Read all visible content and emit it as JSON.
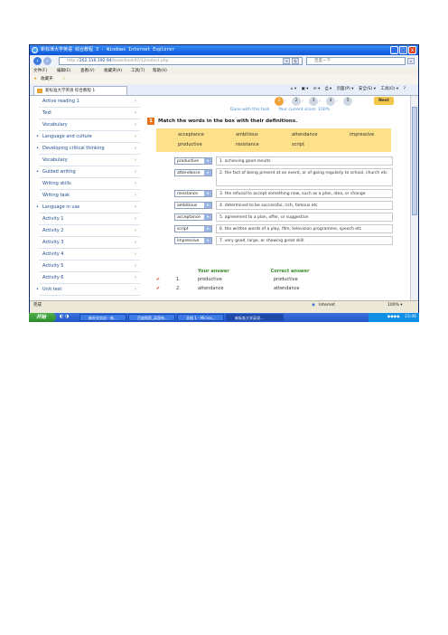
{
  "window": {
    "title": "新标准大学英语 综合教程 3 - Windows Internet Explorer",
    "min": "_",
    "max": "□",
    "close": "x"
  },
  "address": {
    "back_icon": "back-arrow-icon",
    "forward_icon": "forward-arrow-icon",
    "url_prefix": "http://",
    "url_host": "202.116.192.94",
    "url_path": "/book/book97/12/select.php",
    "search_placeholder": "百度一下"
  },
  "menu": [
    "文件(F)",
    "编辑(E)",
    "查看(V)",
    "收藏夹(A)",
    "工具(T)",
    "帮助(H)"
  ],
  "favorites": {
    "label": "收藏夹"
  },
  "tab": {
    "label": "新标准大学英语 综合教程 1"
  },
  "toolbar": {
    "page": "页面(P) ▾",
    "safety": "安全(S) ▾",
    "tools": "工具(O) ▾",
    "help": "?"
  },
  "sidebar": {
    "items": [
      {
        "label": "Active reading 1"
      },
      {
        "label": "Text"
      },
      {
        "label": "Vocabulary"
      },
      {
        "label": "Language and culture"
      },
      {
        "label": "Developing critical thinking"
      },
      {
        "label": "Vocabulary"
      },
      {
        "label": "Guided writing"
      },
      {
        "label": "Writing skills"
      },
      {
        "label": "Writing task"
      },
      {
        "label": "Language in use"
      },
      {
        "label": "Activity 1"
      },
      {
        "label": "Activity 2"
      },
      {
        "label": "Activity 3"
      },
      {
        "label": "Activity 4"
      },
      {
        "label": "Activity 5"
      },
      {
        "label": "Activity 6"
      },
      {
        "label": "Unit test"
      }
    ],
    "chevron": "›"
  },
  "progress": {
    "steps": [
      "1",
      "2",
      "3",
      "4",
      "5"
    ],
    "active_step": 0,
    "next_label": "Next"
  },
  "status": {
    "done": "Done with this task",
    "score": "Your current score: 100%"
  },
  "instruction": {
    "number": "1",
    "text": "Match the words in the box with their definitions."
  },
  "word_box": [
    "acceptance",
    "ambitious",
    "attendance",
    "impressive",
    "productive",
    "resistance",
    "script"
  ],
  "matches": [
    {
      "word": "productive",
      "definition": "1. achieving good results"
    },
    {
      "word": "attendance",
      "definition": "2. the fact of being present at an event, or of going regularly to school, church etc"
    },
    {
      "word": "resistance",
      "definition": "3. the refusal to accept something new, such as a plan, idea, or change"
    },
    {
      "word": "ambitious",
      "definition": "4. determined to be successful, rich, famous etc"
    },
    {
      "word": "acceptance",
      "definition": "5. agreement to a plan, offer, or suggestion"
    },
    {
      "word": "script",
      "definition": "6. the written words of a play, film, television programme, speech etc"
    },
    {
      "word": "impressive",
      "definition": "7. very good, large, or showing great skill"
    }
  ],
  "answers": {
    "your_answer": "Your answer",
    "correct_answer": "Correct answer",
    "rows": [
      {
        "n": "1.",
        "yours": "productive",
        "correct": "productive"
      },
      {
        "n": "2.",
        "yours": "attendance",
        "correct": "attendance"
      }
    ]
  },
  "statusbar": {
    "left": "完成",
    "zone": "Internet",
    "zoom": "100% ▾"
  },
  "taskbar": {
    "start": "开始",
    "buttons": [
      "新外交实训 - 新...",
      "百度搜索_英国有...",
      "文档 1 - Micros...",
      "新标准大学英语..."
    ],
    "clock": "23:46"
  }
}
